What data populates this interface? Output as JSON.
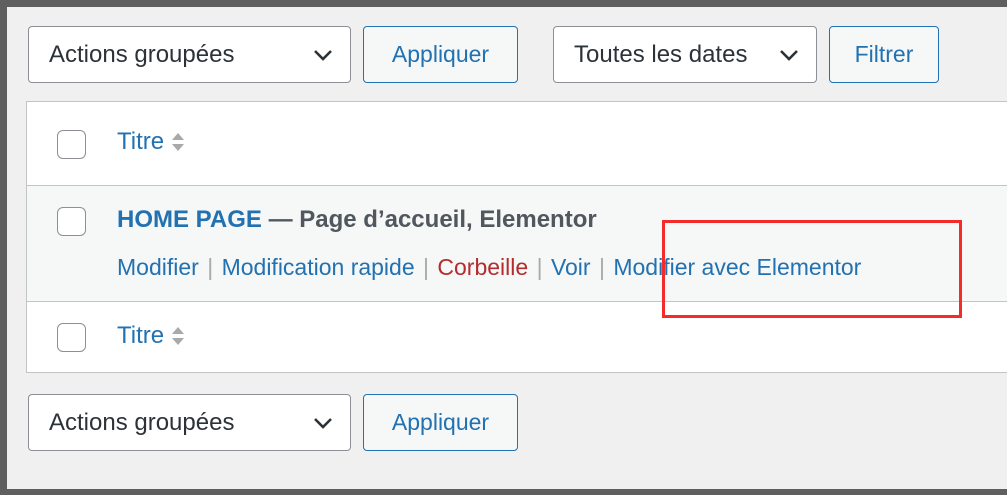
{
  "top_bar": {
    "bulk_select_value": "Actions groupées",
    "apply_label": "Appliquer",
    "dates_select_value": "Toutes les dates",
    "filter_label": "Filtrer"
  },
  "table": {
    "header_column_title": "Titre",
    "footer_column_title": "Titre",
    "row": {
      "title": "HOME PAGE",
      "separator": " — ",
      "states": "Page d’accueil, Elementor",
      "actions": {
        "edit": "Modifier",
        "quick_edit": "Modification rapide",
        "trash": "Corbeille",
        "view": "Voir",
        "edit_elementor": "Modifier avec Elementor",
        "divider": "|"
      }
    }
  },
  "bottom_bar": {
    "bulk_select_value": "Actions groupées",
    "apply_label": "Appliquer"
  },
  "icons": {
    "dropdown": "chevron-down-icon",
    "sort": "sort-arrows-icon"
  },
  "colors": {
    "link": "#2271b1",
    "trash": "#b32d2e",
    "highlight_box": "#f32b2b",
    "frame": "#5f5f5f"
  }
}
